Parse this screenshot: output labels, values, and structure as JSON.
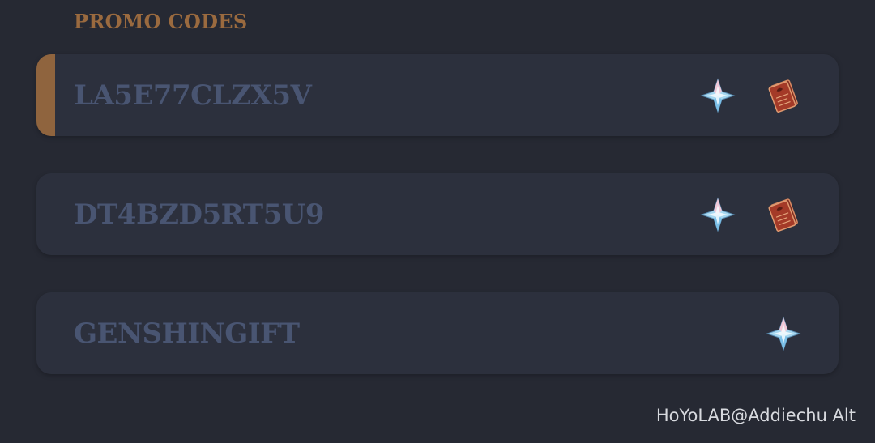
{
  "section": {
    "title": "PROMO CODES"
  },
  "codes": [
    {
      "code": "LA5E77CLZX5V",
      "active": true,
      "rewards": [
        "primogem-icon",
        "heros-wit-book-icon"
      ]
    },
    {
      "code": "DT4BZD5RT5U9",
      "active": false,
      "rewards": [
        "primogem-icon",
        "heros-wit-book-icon"
      ]
    },
    {
      "code": "GENSHINGIFT",
      "active": false,
      "rewards": [
        "primogem-icon"
      ]
    }
  ],
  "watermark": "HoYoLAB@Addiechu Alt",
  "colors": {
    "background": "#262933",
    "card": "#2c303d",
    "code_text": "#495572",
    "accent": "#8f643e",
    "title": "#9a6a3f",
    "watermark": "#d7d9de"
  }
}
